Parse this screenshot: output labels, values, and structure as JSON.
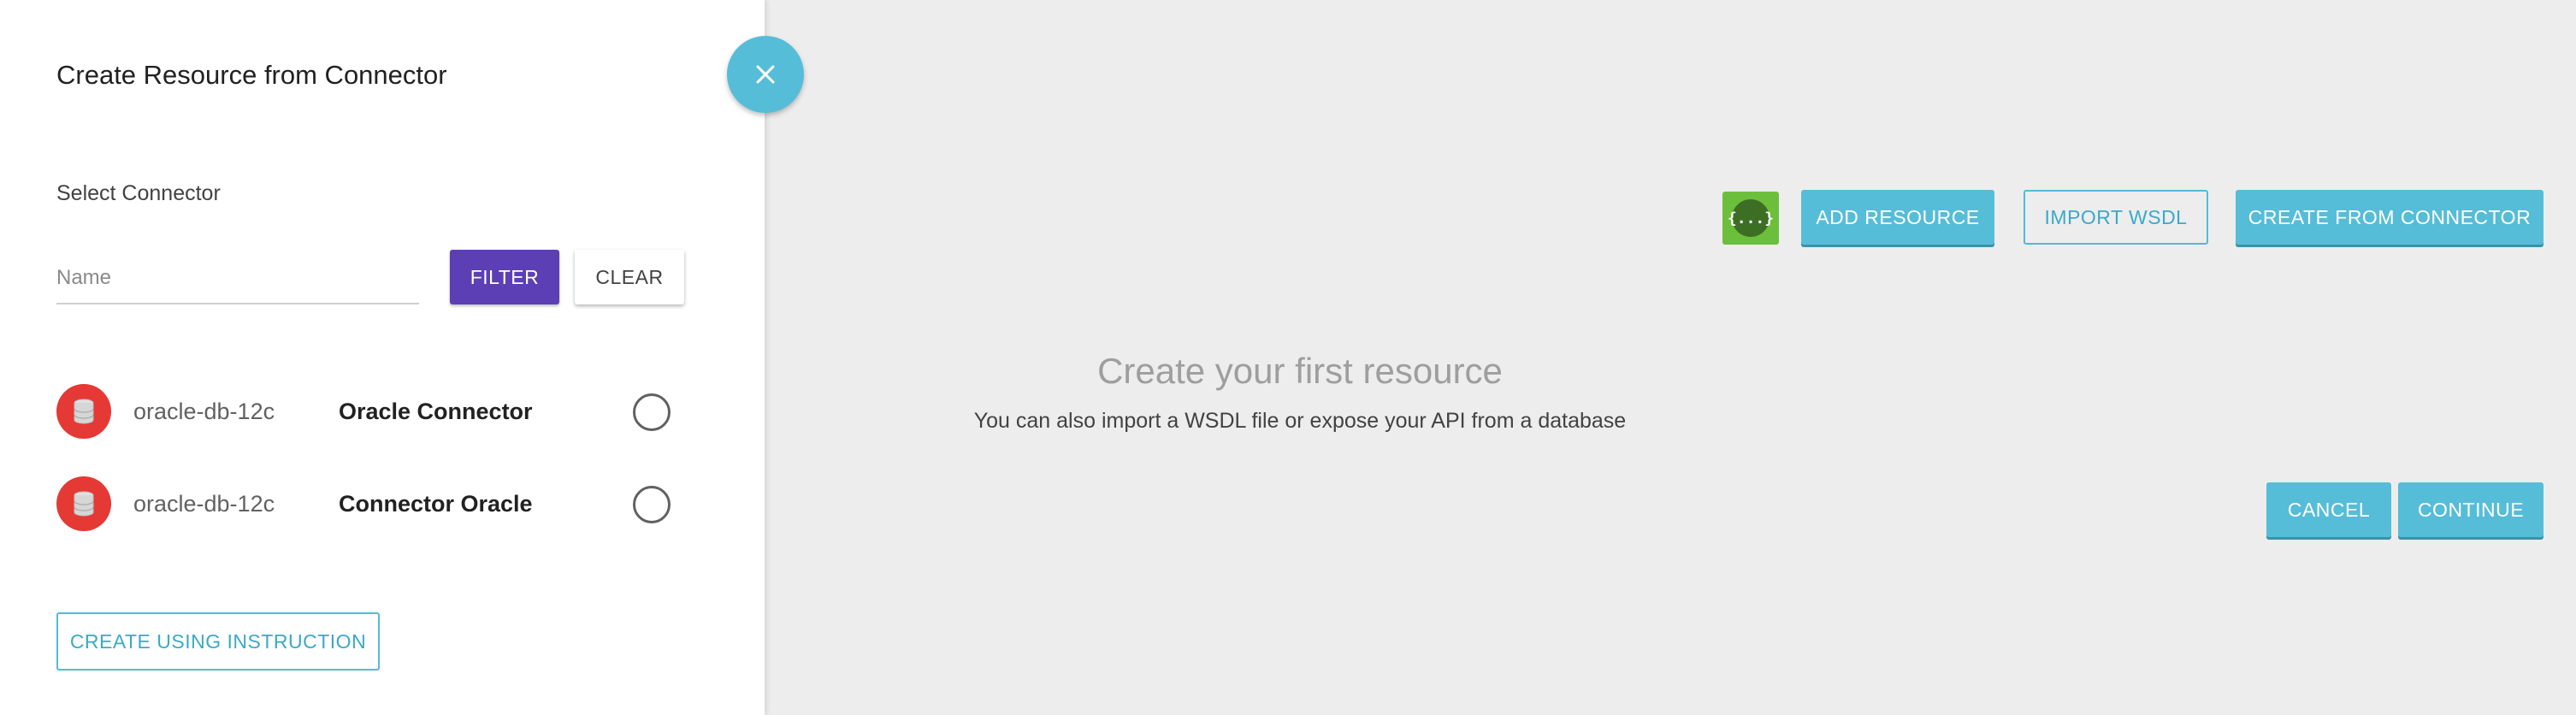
{
  "drawer": {
    "title": "Create Resource from Connector",
    "section_label": "Select Connector",
    "filter": {
      "placeholder": "Name",
      "value": "",
      "filter_label": "FILTER",
      "clear_label": "CLEAR"
    },
    "connectors": [
      {
        "id": "oracle-db-12c",
        "name": "Oracle Connector",
        "icon": "database-icon",
        "selected": false
      },
      {
        "id": "oracle-db-12c",
        "name": "Connector Oracle",
        "icon": "database-icon",
        "selected": false
      }
    ],
    "instruction_label": "CREATE USING INSTRUCTION"
  },
  "close_icon": "close-icon",
  "main": {
    "toolbar": {
      "swagger_badge_glyph": "{...}",
      "add_resource_label": "ADD RESOURCE",
      "import_wsdl_label": "IMPORT WSDL",
      "create_from_connector_label": "CREATE FROM CONNECTOR"
    },
    "empty_state": {
      "title": "Create your first resource",
      "subtitle": "You can also import a WSDL file or expose your API from a database"
    },
    "actions": {
      "cancel_label": "CANCEL",
      "continue_label": "CONTINUE"
    }
  },
  "colors": {
    "accent": "#56bdd8",
    "filter_button": "#5c3fb5",
    "connector_badge": "#e53935",
    "swagger_badge": "#6cbf3a",
    "background": "#ededed"
  }
}
